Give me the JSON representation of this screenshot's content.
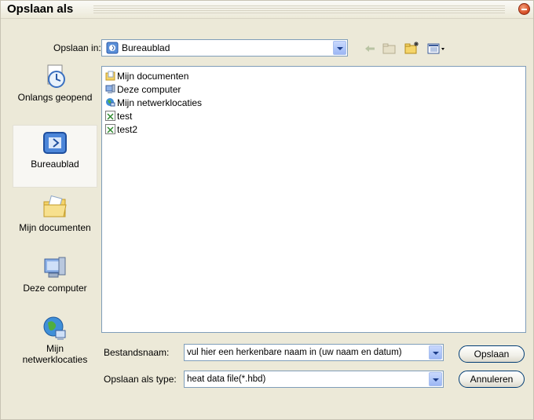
{
  "window": {
    "title": "Opslaan als"
  },
  "toolbar": {
    "save_in_label": "Opslaan in:",
    "save_in_value": "Bureaublad",
    "back_icon": "back-arrow-icon",
    "up_icon": "up-folder-icon",
    "new_folder_icon": "new-folder-icon",
    "view_icon": "view-menu-icon"
  },
  "places": [
    {
      "label": "Onlangs geopend",
      "icon": "recent-icon"
    },
    {
      "label": "Bureaublad",
      "icon": "desktop-icon"
    },
    {
      "label": "Mijn documenten",
      "icon": "my-documents-icon"
    },
    {
      "label": "Deze computer",
      "icon": "my-computer-icon"
    },
    {
      "label": "Mijn netwerklocaties",
      "icon": "network-icon"
    }
  ],
  "files": [
    {
      "name": "Mijn documenten",
      "icon": "my-documents-icon"
    },
    {
      "name": "Deze computer",
      "icon": "my-computer-icon"
    },
    {
      "name": "Mijn netwerklocaties",
      "icon": "network-icon"
    },
    {
      "name": "test",
      "icon": "hbd-file-icon"
    },
    {
      "name": "test2",
      "icon": "hbd-file-icon"
    }
  ],
  "form": {
    "filename_label": "Bestandsnaam:",
    "filename_value": "vul hier een herkenbare naam in (uw naam en datum)",
    "filetype_label": "Opslaan als type:",
    "filetype_value": "heat data file(*.hbd)"
  },
  "buttons": {
    "save": "Opslaan",
    "cancel": "Annuleren"
  }
}
